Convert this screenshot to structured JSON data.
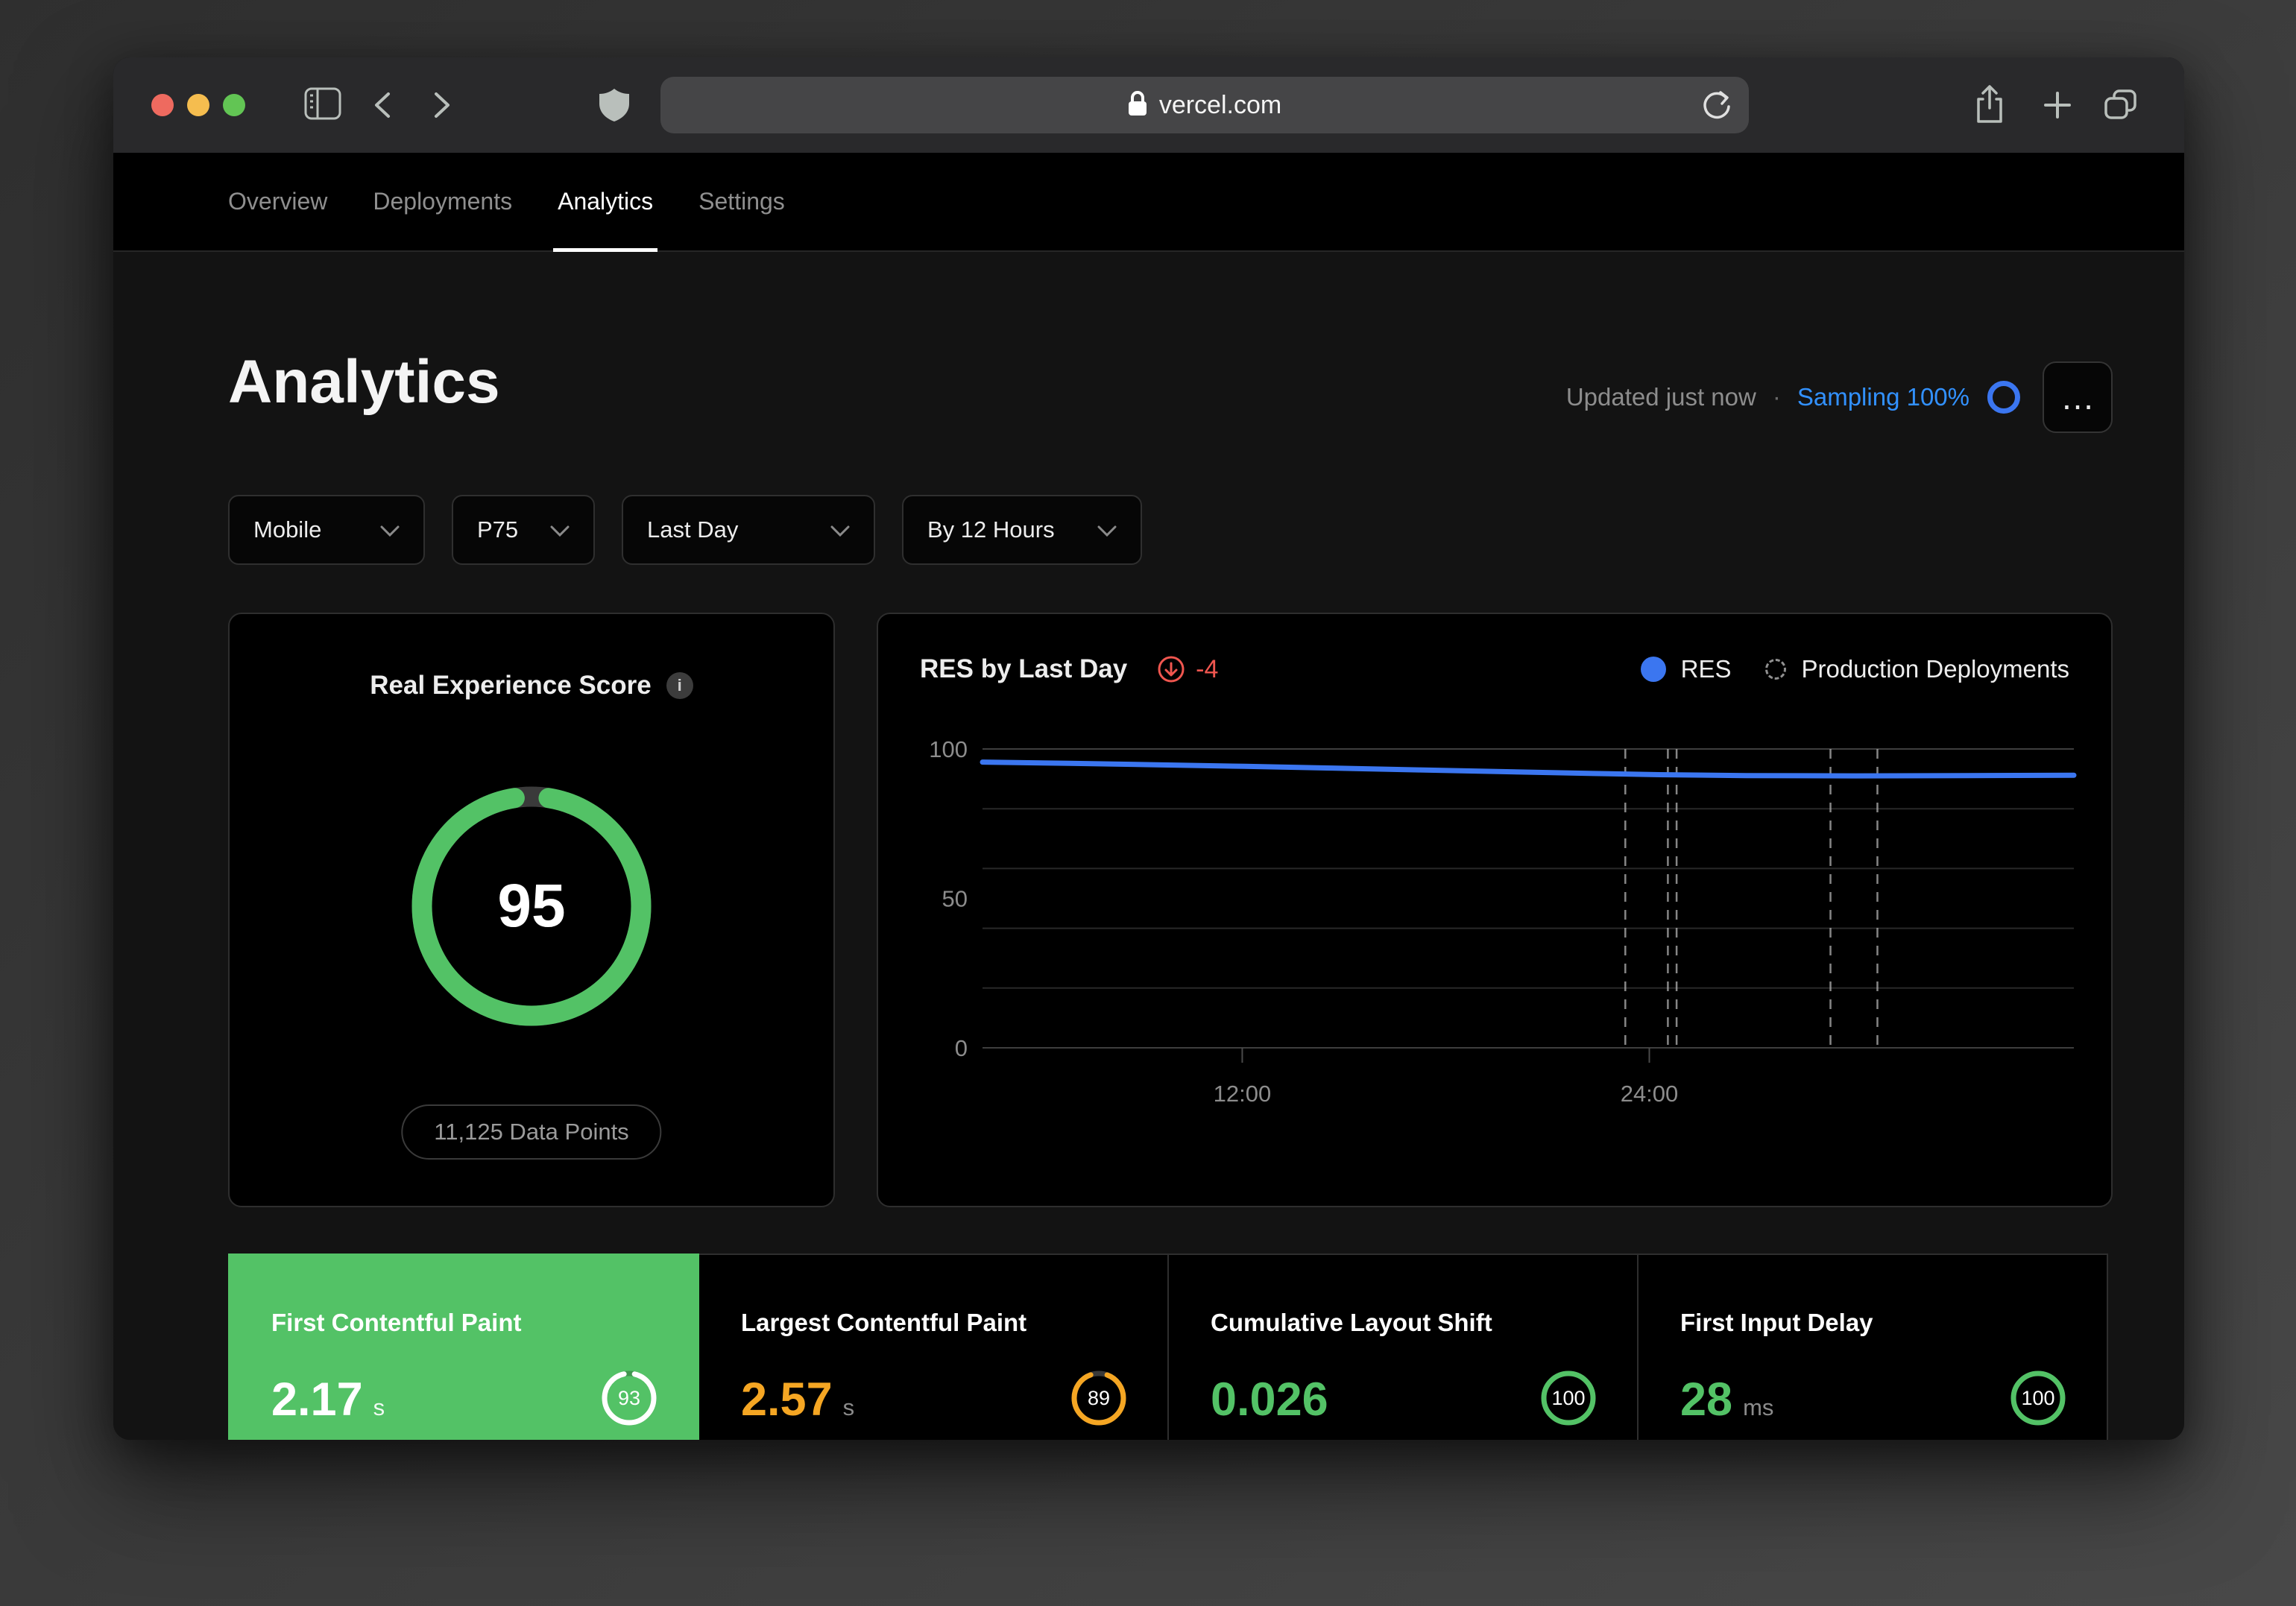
{
  "colors": {
    "green": "#53c266",
    "orange": "#f5a623",
    "red": "#f0564f",
    "blue": "#3b76f0",
    "sampling_blue": "#3291ff"
  },
  "browser": {
    "url": "vercel.com"
  },
  "nav": {
    "tabs": [
      {
        "label": "Overview"
      },
      {
        "label": "Deployments"
      },
      {
        "label": "Analytics"
      },
      {
        "label": "Settings"
      }
    ],
    "active": "Analytics"
  },
  "page": {
    "title": "Analytics",
    "updated": "Updated just now",
    "separator": "·",
    "sampling_label": "Sampling 100%",
    "more_label": "…"
  },
  "filters": [
    {
      "label": "Mobile"
    },
    {
      "label": "P75"
    },
    {
      "label": "Last Day"
    },
    {
      "label": "By 12 Hours"
    }
  ],
  "res_card": {
    "title": "Real Experience Score",
    "info_icon": "i",
    "score": 95,
    "data_points_label": "11,125 Data Points"
  },
  "chart_card": {
    "title": "RES by Last Day",
    "delta_label": "-4",
    "legend": [
      {
        "label": "RES"
      },
      {
        "label": "Production Deployments"
      }
    ]
  },
  "chart_data": {
    "type": "line",
    "title": "RES by Last Day",
    "delta": -4,
    "ylim": [
      0,
      100
    ],
    "y_ticks": [
      100,
      50,
      0
    ],
    "gridline_values": [
      100,
      80,
      60,
      40,
      20,
      0
    ],
    "grid": "horizontal",
    "legend_position": "top-right",
    "x_ticks": [
      {
        "label": "12:00",
        "fraction": 0.238
      },
      {
        "label": "24:00",
        "fraction": 0.611
      }
    ],
    "series": [
      {
        "name": "RES",
        "color": "#3b76f0",
        "points": [
          [
            0,
            95.6
          ],
          [
            0.08,
            95.2
          ],
          [
            0.16,
            94.7
          ],
          [
            0.24,
            94.2
          ],
          [
            0.32,
            93.6
          ],
          [
            0.4,
            93.0
          ],
          [
            0.48,
            92.4
          ],
          [
            0.56,
            91.8
          ],
          [
            0.62,
            91.4
          ],
          [
            0.7,
            91.1
          ],
          [
            0.8,
            91.0
          ],
          [
            0.9,
            91.1
          ],
          [
            1,
            91.2
          ]
        ]
      }
    ],
    "deployment_markers": {
      "name": "Production Deployments",
      "fractions": [
        0.589,
        0.628,
        0.636,
        0.777,
        0.82
      ]
    }
  },
  "metrics": [
    {
      "title": "First Contentful Paint",
      "value": "2.17",
      "unit": "s",
      "score": 93,
      "selected": true,
      "accent": "green"
    },
    {
      "title": "Largest Contentful Paint",
      "value": "2.57",
      "unit": "s",
      "score": 89,
      "selected": false,
      "accent": "orange"
    },
    {
      "title": "Cumulative Layout Shift",
      "value": "0.026",
      "unit": "",
      "score": 100,
      "selected": false,
      "accent": "green"
    },
    {
      "title": "First Input Delay",
      "value": "28",
      "unit": "ms",
      "score": 100,
      "selected": false,
      "accent": "green"
    }
  ]
}
